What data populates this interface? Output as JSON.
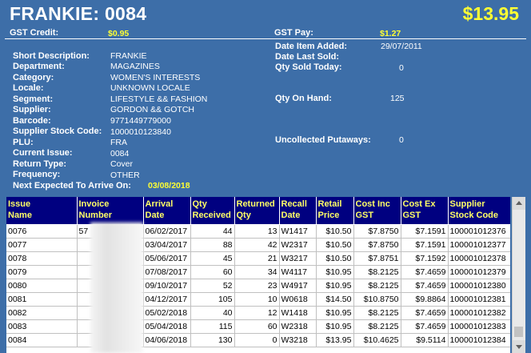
{
  "header": {
    "title": "FRANKIE: 0084",
    "price": "$13.95"
  },
  "gst": {
    "credit_label": "GST Credit:",
    "credit_value": "$0.95",
    "pay_label": "GST Pay:",
    "pay_value": "$1.27"
  },
  "details": {
    "short_description": {
      "label": "Short Description:",
      "value": "FRANKIE"
    },
    "department": {
      "label": "Department:",
      "value": "MAGAZINES"
    },
    "category": {
      "label": "Category:",
      "value": "WOMEN'S INTERESTS"
    },
    "locale": {
      "label": "Locale:",
      "value": "UNKNOWN LOCALE"
    },
    "segment": {
      "label": "Segment:",
      "value": "LIFESTYLE && FASHION"
    },
    "supplier": {
      "label": "Supplier:",
      "value": "GORDON && GOTCH"
    },
    "barcode": {
      "label": "Barcode:",
      "value": "9771449779000"
    },
    "supplier_stock_code": {
      "label": "Supplier Stock Code:",
      "value": "1000010123840"
    },
    "plu": {
      "label": "PLU:",
      "value": "FRA"
    },
    "current_issue": {
      "label": "Current Issue:",
      "value": "0084"
    },
    "return_type": {
      "label": "Return Type:",
      "value": "Cover"
    },
    "frequency": {
      "label": "Frequency:",
      "value": "OTHER"
    },
    "next_expected": {
      "label": "Next Expected To Arrive On:",
      "value": "03/08/2018"
    }
  },
  "stats": {
    "date_added": {
      "label": "Date Item Added:",
      "value": "29/07/2011"
    },
    "date_last_sold": {
      "label": "Date Last Sold:",
      "value": ""
    },
    "qty_sold_today": {
      "label": "Qty Sold Today:",
      "value": "0"
    },
    "qty_on_hand": {
      "label": "Qty On Hand:",
      "value": "125"
    },
    "uncollected_putaways": {
      "label": "Uncollected Putaways:",
      "value": "0"
    }
  },
  "grid": {
    "columns": [
      [
        "Issue",
        "Name"
      ],
      [
        "Invoice",
        "Number"
      ],
      [
        "Arrival",
        "Date"
      ],
      [
        "Qty",
        "Received"
      ],
      [
        "Returned",
        "Qty"
      ],
      [
        "Recall",
        "Date"
      ],
      [
        "Retail",
        "Price"
      ],
      [
        "Cost Inc",
        "GST"
      ],
      [
        "Cost Ex",
        "GST"
      ],
      [
        "Supplier",
        "Stock Code"
      ]
    ],
    "rows": [
      [
        "0076",
        "57",
        "06/02/2017",
        "44",
        "13",
        "W1417",
        "$10.50",
        "$7.8750",
        "$7.1591",
        "100001012376"
      ],
      [
        "0077",
        "",
        "03/04/2017",
        "88",
        "42",
        "W2317",
        "$10.50",
        "$7.8750",
        "$7.1591",
        "100001012377"
      ],
      [
        "0078",
        "",
        "05/06/2017",
        "45",
        "21",
        "W3217",
        "$10.50",
        "$7.8751",
        "$7.1592",
        "100001012378"
      ],
      [
        "0079",
        "",
        "07/08/2017",
        "60",
        "34",
        "W4117",
        "$10.95",
        "$8.2125",
        "$7.4659",
        "100001012379"
      ],
      [
        "0080",
        "",
        "09/10/2017",
        "52",
        "23",
        "W4917",
        "$10.95",
        "$8.2125",
        "$7.4659",
        "100001012380"
      ],
      [
        "0081",
        "",
        "04/12/2017",
        "105",
        "10",
        "W0618",
        "$14.50",
        "$10.8750",
        "$9.8864",
        "100001012381"
      ],
      [
        "0082",
        "",
        "05/02/2018",
        "40",
        "12",
        "W1418",
        "$10.95",
        "$8.2125",
        "$7.4659",
        "100001012382"
      ],
      [
        "0083",
        "",
        "05/04/2018",
        "115",
        "60",
        "W2318",
        "$10.95",
        "$8.2125",
        "$7.4659",
        "100001012383"
      ],
      [
        "0084",
        "",
        "04/06/2018",
        "130",
        "0",
        "W3218",
        "$13.95",
        "$10.4625",
        "$9.5114",
        "100001012384"
      ]
    ]
  }
}
